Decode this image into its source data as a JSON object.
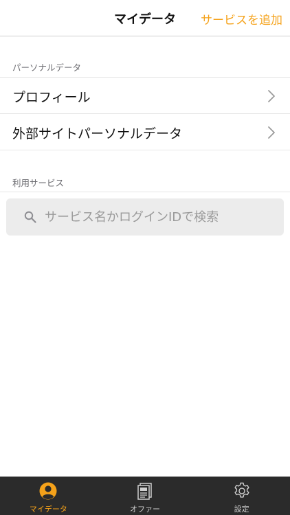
{
  "navbar": {
    "title": "マイデータ",
    "action_label": "サービスを追加"
  },
  "personal_section": {
    "header": "パーソナルデータ",
    "items": [
      {
        "label": "プロフィール"
      },
      {
        "label": "外部サイトパーソナルデータ"
      }
    ]
  },
  "services_section": {
    "header": "利用サービス",
    "search_placeholder": "サービス名かログインIDで検索"
  },
  "tabbar": {
    "tabs": [
      {
        "label": "マイデータ",
        "icon": "user-icon",
        "active": true
      },
      {
        "label": "オファー",
        "icon": "newspaper-icon",
        "active": false
      },
      {
        "label": "設定",
        "icon": "gear-icon",
        "active": false
      }
    ]
  },
  "colors": {
    "accent": "#f5a21a",
    "tabbar_bg": "#2b2b2b",
    "search_bg": "#ececec"
  }
}
